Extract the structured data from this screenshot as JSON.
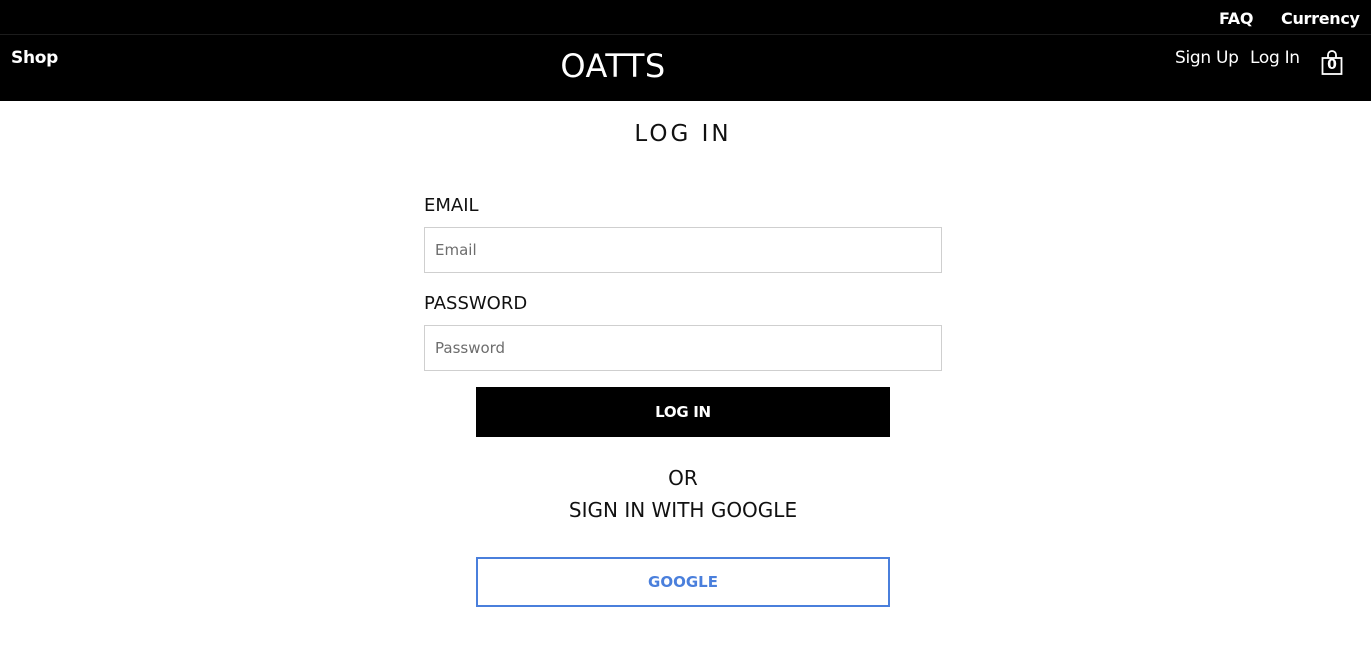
{
  "top_bar": {
    "faq": "FAQ",
    "currency": "Currency"
  },
  "header": {
    "shop": "Shop",
    "brand": "OATTS",
    "sign_up": "Sign Up",
    "log_in": "Log In",
    "cart_count": "0",
    "cart_icon": "shopping-bag-icon"
  },
  "login": {
    "title": "LOG IN",
    "email_label": "EMAIL",
    "email_placeholder": "Email",
    "email_value": "",
    "password_label": "PASSWORD",
    "password_placeholder": "Password",
    "password_value": "",
    "submit_label": "LOG IN",
    "or_text": "OR",
    "google_prompt": "SIGN IN WITH GOOGLE",
    "google_button": "GOOGLE"
  },
  "colors": {
    "header_bg": "#000000",
    "google_accent": "#4a7fdc"
  }
}
